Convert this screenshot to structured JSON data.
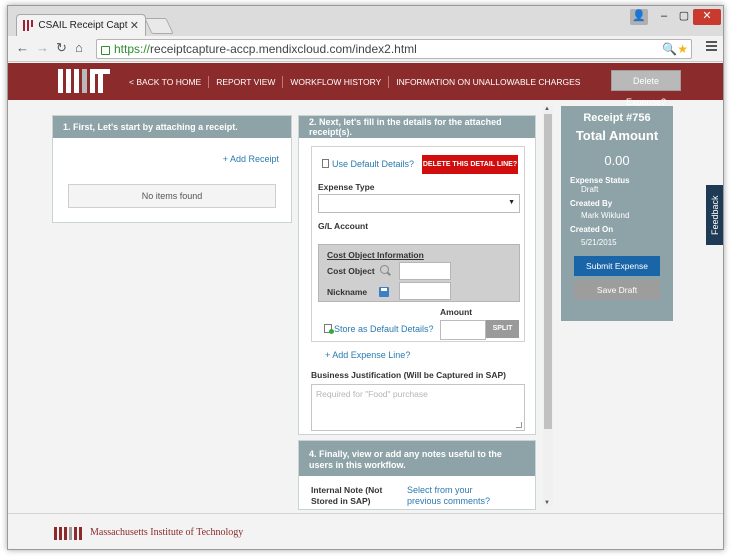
{
  "browser": {
    "tab_title": "CSAIL Receipt Capture - C",
    "url_scheme": "https://",
    "url_rest": "receiptcapture-accp.mendixcloud.com/index2.html"
  },
  "header": {
    "nav": [
      "< BACK TO HOME",
      "REPORT VIEW",
      "WORKFLOW HISTORY",
      "INFORMATION ON UNALLOWABLE CHARGES"
    ],
    "delete_expense": "Delete Expense?"
  },
  "step1": {
    "title": "1. First, Let's start by attaching a receipt.",
    "add_receipt": "+ Add Receipt",
    "empty_text": "No items found"
  },
  "step2": {
    "title": "2. Next, let's fill in the details for the attached receipt(s).",
    "use_default": "Use Default Details?",
    "delete_line": "DELETE THIS DETAIL LINE?",
    "expense_type_label": "Expense Type",
    "gl_account_label": "G/L Account",
    "cost_object_info": "Cost Object Information",
    "cost_object_label": "Cost Object",
    "nickname_label": "Nickname",
    "amount_label": "Amount",
    "split": "SPLIT",
    "store_default": "Store as Default Details?",
    "add_expense_line": "+ Add Expense Line?",
    "justification_label": "Business Justification (Will be Captured in SAP)",
    "justification_placeholder": "Required for \"Food\" purchase"
  },
  "step4": {
    "title": "4. Finally, view or add any notes useful to the users in this workflow.",
    "internal_note": "Internal Note (Not Stored in SAP)",
    "select_comments": "Select from your previous comments?"
  },
  "receipt": {
    "title": "Receipt #756",
    "total_label": "Total Amount",
    "amount": "0.00",
    "status_label": "Expense Status",
    "status_value": "Draft",
    "created_by_label": "Created By",
    "created_by_value": "Mark Wiklund",
    "created_on_label": "Created On",
    "created_on_value": "5/21/2015",
    "submit": "Submit Expense",
    "save": "Save Draft"
  },
  "feedback": "Feedback",
  "footer": {
    "text": "Massachusetts Institute of Technology"
  }
}
